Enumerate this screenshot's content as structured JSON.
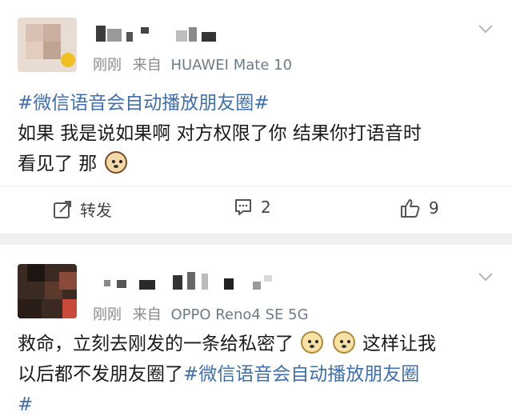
{
  "posts": [
    {
      "time": "刚刚",
      "via": "来自",
      "device": "HUAWEI Mate 10",
      "topic": "#微信语音会自动播放朋友圈#",
      "text_line1": "如果 我是说如果啊 对方权限了你 结果你打语音时",
      "text_line2": "看见了 那",
      "emoji_1": "cat-emoji",
      "actions": {
        "repost_label": "转发",
        "comment_count": "2",
        "like_count": "9"
      }
    },
    {
      "time": "刚刚",
      "via": "来自",
      "device": "OPPO Reno4 SE 5G",
      "text_line1_a": "救命，立刻去刚发的一条给私密了",
      "text_line1_b": "这样让我",
      "text_line2_a": "以后都不发朋友圈了",
      "topic": "#微信语音会自动播放朋友圈",
      "text_line3": "#",
      "emoji_1": "doge-emoji",
      "emoji_2": "doge-emoji"
    }
  ],
  "icons": {
    "more": "chevron-down-icon",
    "repost": "repost-icon",
    "comment": "comment-icon",
    "like": "thumbs-up-icon"
  },
  "colors": {
    "topic": "#3f6fae",
    "meta": "#8a8a8a",
    "separator": "#efefef"
  }
}
